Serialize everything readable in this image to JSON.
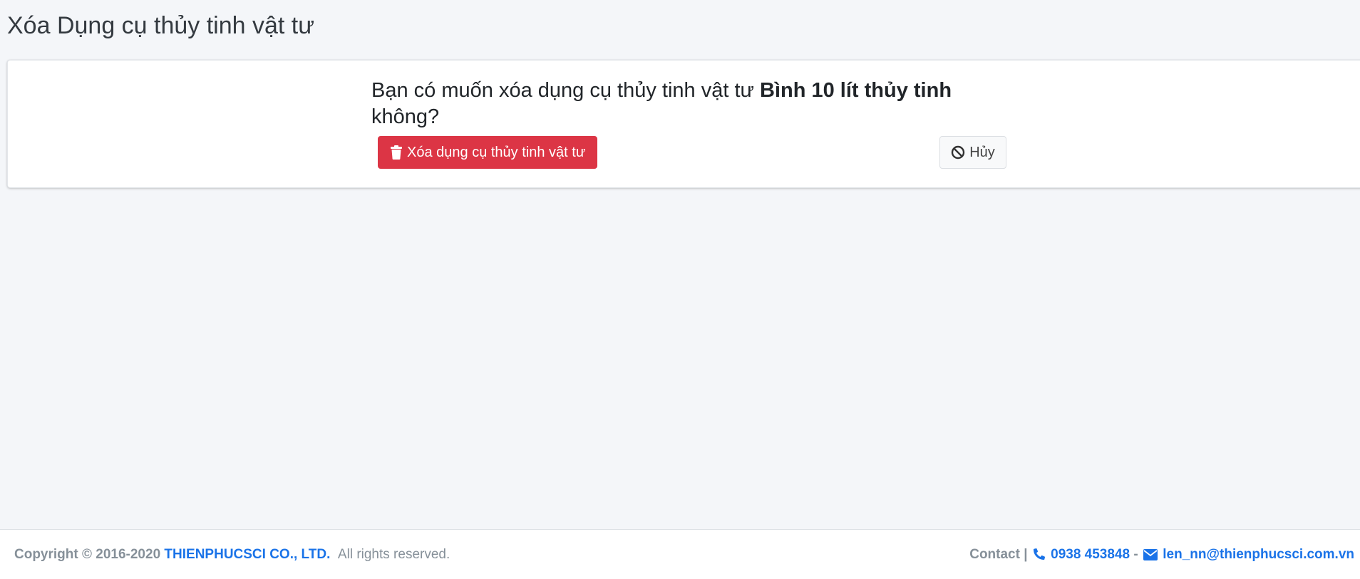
{
  "page": {
    "title": "Xóa Dụng cụ thủy tinh vật tư"
  },
  "confirm": {
    "question_prefix": "Bạn có muốn xóa dụng cụ thủy tinh vật tư",
    "item_name": "Bình 10 lít thủy tinh",
    "question_suffix": "không?",
    "delete_label": "Xóa dụng cụ thủy tinh vật tư",
    "delete_icon": "trash-icon",
    "cancel_label": "Hủy",
    "cancel_icon": "ban-icon"
  },
  "footer": {
    "copyright_prefix": "Copyright © 2016-2020",
    "company": "THIENPHUCSCI CO., LTD.",
    "rights": "All rights reserved.",
    "contact_label": "Contact |",
    "phone_icon": "phone-icon",
    "phone": "0938 453848",
    "separator": "-",
    "email_icon": "envelope-icon",
    "email": "len_nn@thienphucsci.com.vn"
  },
  "colors": {
    "danger": "#dc3545",
    "link": "#1a73e8",
    "background": "#f4f6f9"
  }
}
